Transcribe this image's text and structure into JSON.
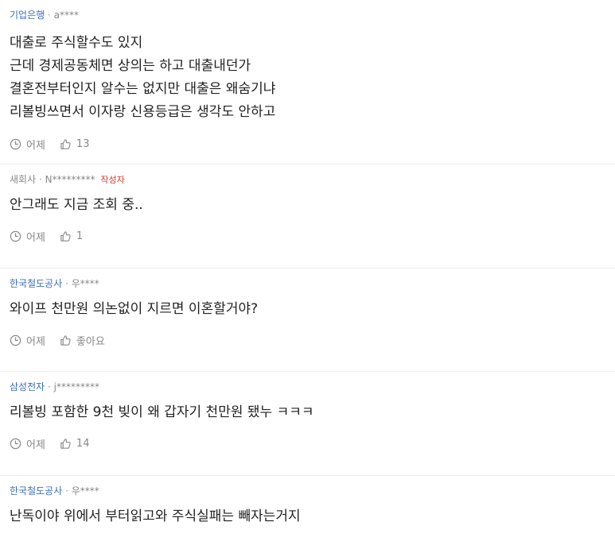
{
  "comments": [
    {
      "company": "기업은행",
      "author": "a****",
      "author_badge": "",
      "lines": [
        "대출로 주식할수도 있지",
        "근데 경제공동체면 상의는 하고 대출내던가",
        "결혼전부터인지 알수는 없지만 대출은 왜숨기냐",
        "리볼빙쓰면서 이자랑 신용등급은 생각도 안하고"
      ],
      "time": "어제",
      "likes": "13"
    },
    {
      "company": "새회사",
      "author": "N*********",
      "author_badge": "작성자",
      "lines": [
        "안그래도 지금 조회 중.."
      ],
      "time": "어제",
      "likes": "1"
    },
    {
      "company": "한국철도공사",
      "author": "우****",
      "author_badge": "",
      "lines": [
        "와이프 천만원 의논없이 지르면 이혼할거야?"
      ],
      "time": "어제",
      "likes": "좋아요"
    },
    {
      "company": "삼성전자",
      "author": "j*********",
      "author_badge": "",
      "lines": [
        "리볼빙 포함한 9천 빚이 왜 갑자기 천만원 됐누 ㅋㅋㅋ"
      ],
      "time": "어제",
      "likes": "14"
    },
    {
      "company": "한국철도공사",
      "author": "우****",
      "author_badge": "",
      "lines": [
        "난독이야 위에서 부터읽고와 주식실패는 빼자는거지"
      ],
      "time": "",
      "likes": ""
    }
  ],
  "separator": "·",
  "icons": {
    "time": "clock-icon",
    "like": "thumbs-up-icon"
  },
  "colors": {
    "company_link": "#3a6ebf",
    "author_badge": "#d0392b",
    "meta_gray": "#888888"
  }
}
